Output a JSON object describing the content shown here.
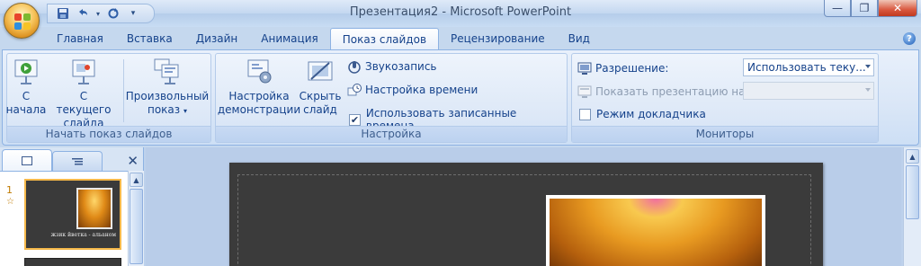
{
  "window": {
    "title": "Презентация2 - Microsoft PowerPoint",
    "minimize": "—",
    "restore": "❐",
    "close": "✕"
  },
  "quick_access": {
    "save_icon": "save-icon",
    "undo_icon": "undo-icon",
    "redo_icon": "redo-icon",
    "customize_icon": "customize-icon"
  },
  "tabs": [
    {
      "label": "Главная",
      "active": false
    },
    {
      "label": "Вставка",
      "active": false
    },
    {
      "label": "Дизайн",
      "active": false
    },
    {
      "label": "Анимация",
      "active": false
    },
    {
      "label": "Показ слайдов",
      "active": true
    },
    {
      "label": "Рецензирование",
      "active": false
    },
    {
      "label": "Вид",
      "active": false
    }
  ],
  "help": "?",
  "ribbon": {
    "start_group": {
      "label": "Начать показ слайдов",
      "from_beginning": "С начала",
      "from_beginning_l1": "С",
      "from_beginning_l2": "начала",
      "from_current_l1": "С текущего",
      "from_current_l2": "слайда",
      "custom_l1": "Произвольный",
      "custom_l2": "показ"
    },
    "setup_group": {
      "label": "Настройка",
      "setup_show_l1": "Настройка",
      "setup_show_l2": "демонстрации",
      "hide_slide_l1": "Скрыть",
      "hide_slide_l2": "слайд",
      "record_narration": "Звукозапись",
      "rehearse_timings": "Настройка времени",
      "use_timings": "Использовать записанные времена",
      "use_timings_checked": true
    },
    "monitors_group": {
      "label": "Мониторы",
      "resolution_label": "Разрешение:",
      "resolution_value": "Использовать теку...",
      "show_on_label": "Показать презентацию на:",
      "show_on_value": "",
      "presenter_view": "Режим докладчика",
      "presenter_view_checked": false
    }
  },
  "slides_panel": {
    "close": "✕",
    "slide_number": "1",
    "slide_star": "☆",
    "thumb_caption": "жзик йветка - альаном"
  },
  "colors": {
    "accent": "#15428b",
    "ribbon_bg": "#dbe7f7",
    "slide_bg": "#3b3b3b",
    "selected_thumb_border": "#f5b84a"
  }
}
